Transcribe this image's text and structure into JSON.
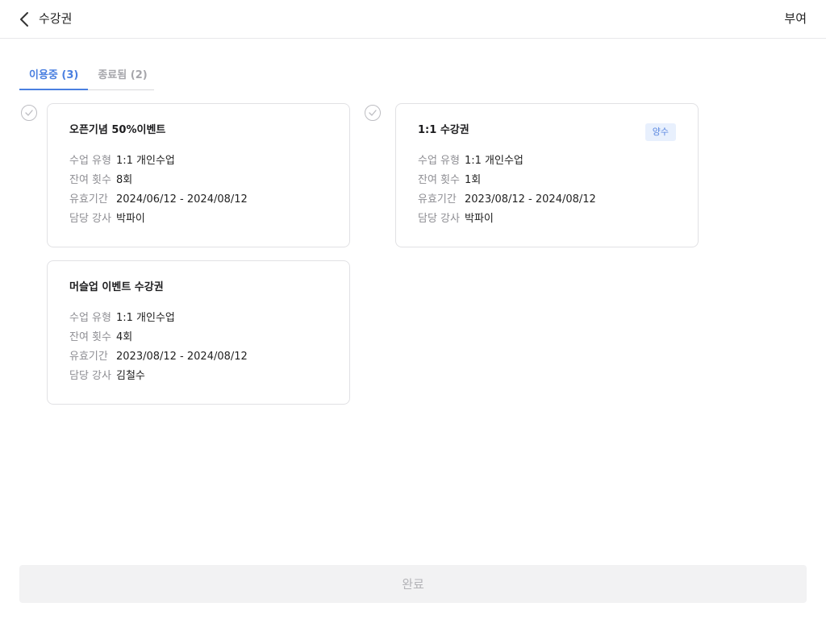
{
  "header": {
    "title": "수강권",
    "action_label": "부여",
    "back_icon": "chevron-left-icon"
  },
  "tabs": [
    {
      "label": "이용중 (3)",
      "active": true
    },
    {
      "label": "종료됨 (2)",
      "active": false
    }
  ],
  "colors": {
    "accent": "#4a7fe0",
    "badge_bg": "#e8f0fd",
    "disabled_button_bg": "#f2f2f3"
  },
  "passes": [
    {
      "title": "오픈기념 50%이벤트",
      "badge": "",
      "rows": [
        {
          "label": "수업 유형",
          "value": "1:1 개인수업"
        },
        {
          "label": "잔여 횟수",
          "value": "8회"
        },
        {
          "label": "유효기간",
          "value": "2024/06/12 - 2024/08/12"
        },
        {
          "label": "담당 강사",
          "value": "박파이"
        }
      ]
    },
    {
      "title": "1:1 수강권",
      "badge": "양수",
      "rows": [
        {
          "label": "수업 유형",
          "value": "1:1 개인수업"
        },
        {
          "label": "잔여 횟수",
          "value": "1회"
        },
        {
          "label": "유효기간",
          "value": "2023/08/12 - 2024/08/12"
        },
        {
          "label": "담당 강사",
          "value": "박파이"
        }
      ]
    },
    {
      "title": "머슬업 이벤트 수강권",
      "badge": "",
      "rows": [
        {
          "label": "수업 유형",
          "value": "1:1 개인수업"
        },
        {
          "label": "잔여 횟수",
          "value": "4회"
        },
        {
          "label": "유효기간",
          "value": "2023/08/12 - 2024/08/12"
        },
        {
          "label": "담당 강사",
          "value": "김철수"
        }
      ]
    }
  ],
  "footer": {
    "complete_label": "완료"
  }
}
